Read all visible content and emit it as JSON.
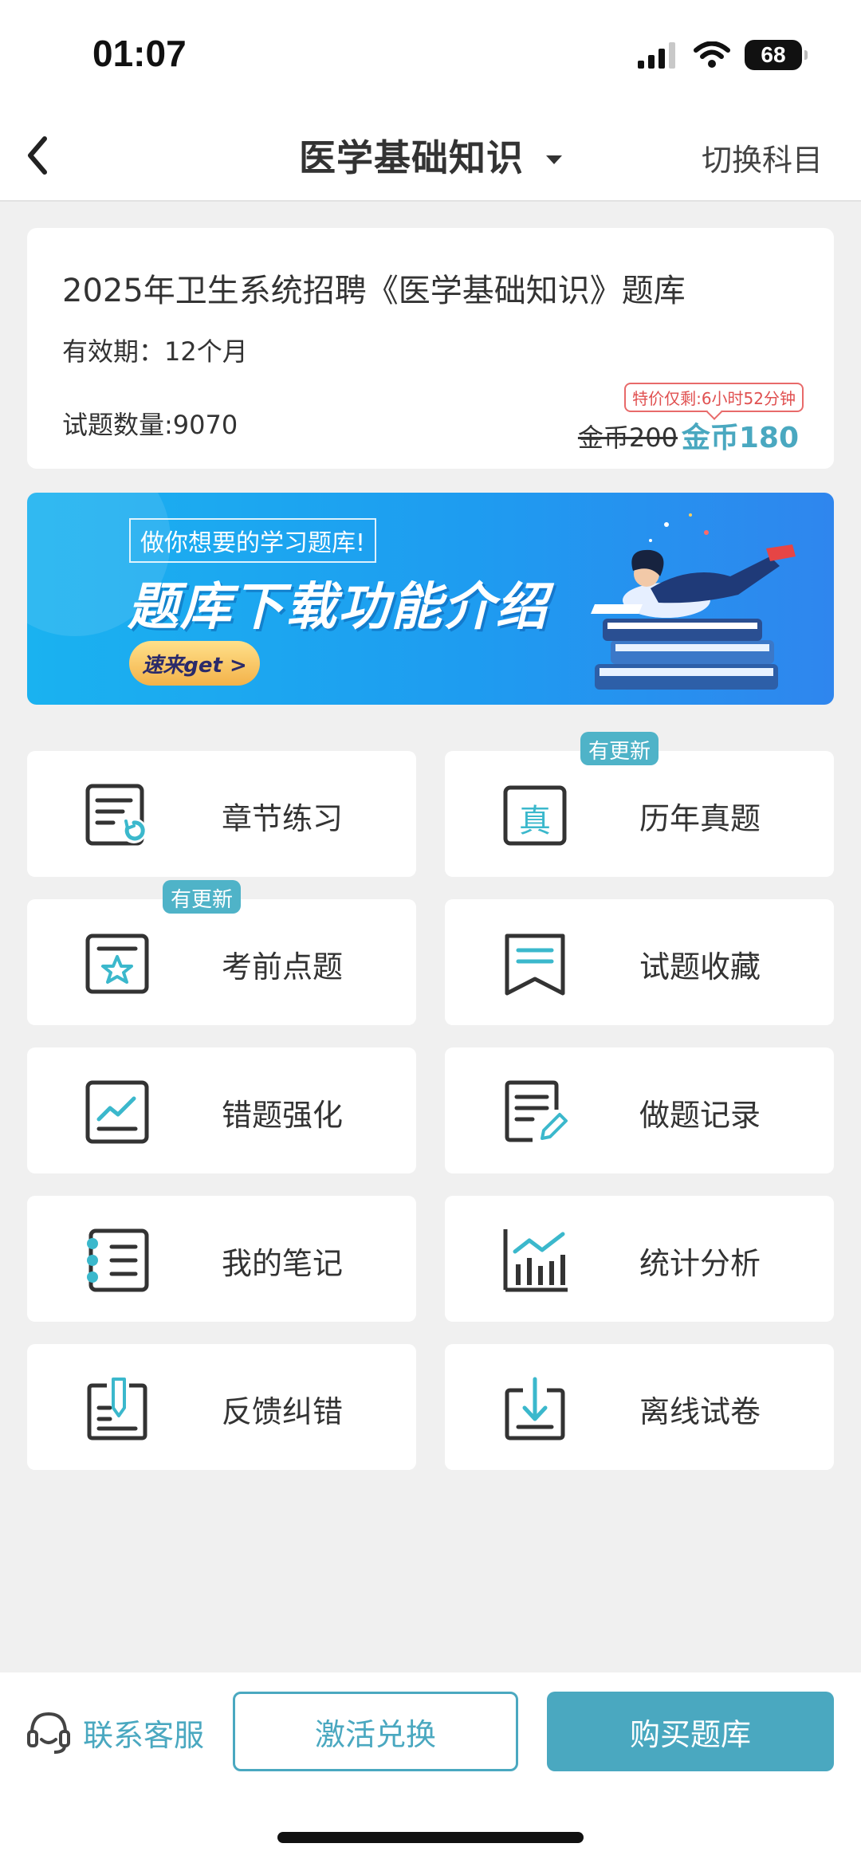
{
  "status_bar": {
    "time": "01:07",
    "battery": "68"
  },
  "nav": {
    "title": "医学基础知识",
    "switch_label": "切换科目"
  },
  "card": {
    "title": "2025年卫生系统招聘《医学基础知识》题库",
    "validity": "有效期：12个月",
    "count": "试题数量:9070",
    "promo": "特价仅剩:6小时52分钟",
    "old_price": "金币200",
    "new_price": "金币180"
  },
  "banner": {
    "subtitle": "做你想要的学习题库!",
    "headline": "题库下载功能介绍",
    "cta": "速来get >"
  },
  "grid": {
    "items": [
      {
        "label": "章节练习",
        "icon": "chapter-practice-icon",
        "badge": ""
      },
      {
        "label": "历年真题",
        "icon": "past-exams-icon",
        "badge": "有更新"
      },
      {
        "label": "考前点题",
        "icon": "pre-exam-icon",
        "badge": "有更新"
      },
      {
        "label": "试题收藏",
        "icon": "favorites-icon",
        "badge": ""
      },
      {
        "label": "错题强化",
        "icon": "mistakes-icon",
        "badge": ""
      },
      {
        "label": "做题记录",
        "icon": "history-icon",
        "badge": ""
      },
      {
        "label": "我的笔记",
        "icon": "notes-icon",
        "badge": ""
      },
      {
        "label": "统计分析",
        "icon": "stats-icon",
        "badge": ""
      },
      {
        "label": "反馈纠错",
        "icon": "feedback-icon",
        "badge": ""
      },
      {
        "label": "离线试卷",
        "icon": "download-icon",
        "badge": ""
      }
    ]
  },
  "bottom": {
    "service": "联系客服",
    "activate": "激活兑换",
    "buy": "购买题库"
  },
  "colors": {
    "accent": "#4aa8c0",
    "promo": "#e05050",
    "banner": "#1ab2f0"
  }
}
